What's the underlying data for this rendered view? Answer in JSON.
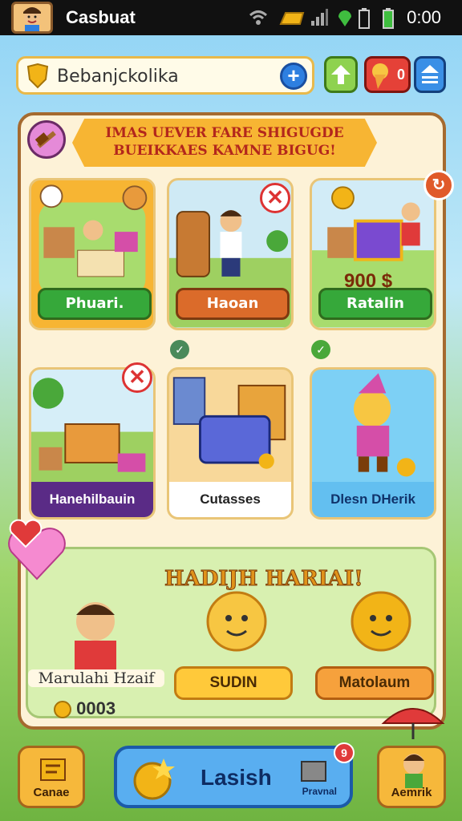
{
  "status_bar": {
    "app_title": "Casbuat",
    "time": "0:00"
  },
  "top_bar": {
    "search_text": "Bebanjckolika",
    "plus_label": "+",
    "badge_count": "0"
  },
  "banner": {
    "line1": "IMAS UEVER FARE SHIGUGDE",
    "line2": "BUEIKKAES KAMNE BIGUG!"
  },
  "cards": [
    {
      "label": "Phuari.",
      "color": "#36a83a"
    },
    {
      "label": "Haoan",
      "color": "#db6b2a"
    },
    {
      "label": "Ratalin",
      "color": "#36a83a",
      "price": "900 $"
    },
    {
      "label": "Hanehilbauin",
      "color": "#5a2b86"
    },
    {
      "label": "Cutasses",
      "color": "#ffffff"
    },
    {
      "label": "Dlesn DHerik",
      "color": "#63bff0"
    }
  ],
  "daily": {
    "title": "HADIJH HARIAI!",
    "player_name": "Marulahi Hzaif",
    "coins": "0003",
    "button1": "SUDIN",
    "button2": "Matolaum"
  },
  "bottom_nav": {
    "left_label": "Canae",
    "center_label": "Lasish",
    "center_sub": "Pravnal",
    "right_label": "Aemrik",
    "notif": "9"
  }
}
